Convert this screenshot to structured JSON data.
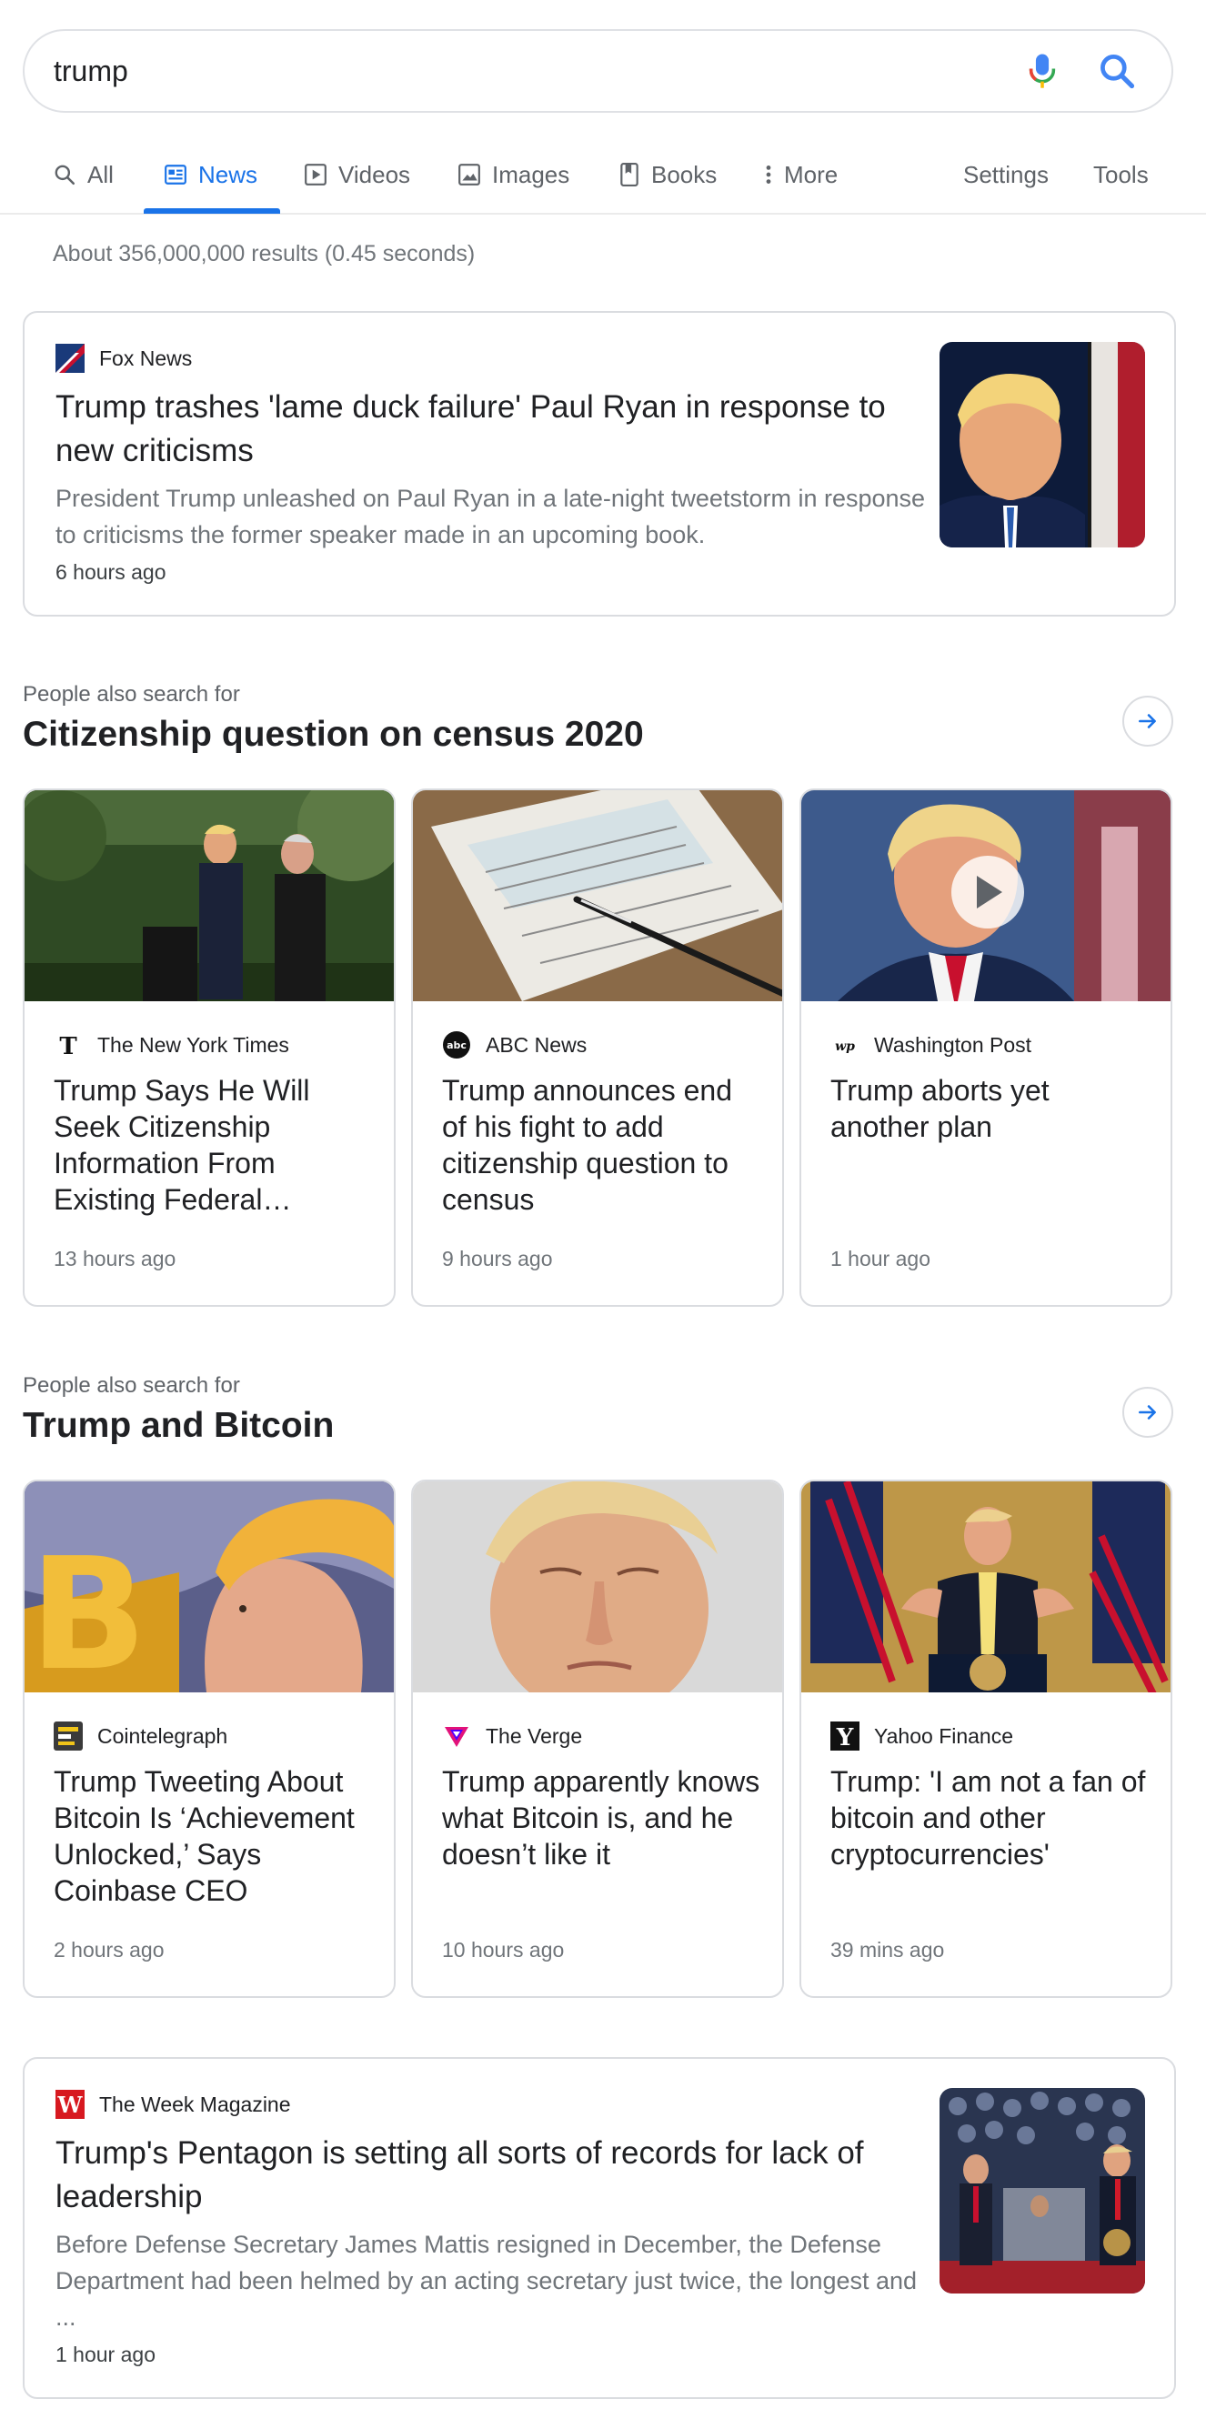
{
  "search": {
    "query": "trump"
  },
  "tabs": [
    {
      "label": "All",
      "icon": "search-icon"
    },
    {
      "label": "News",
      "icon": "news-icon",
      "active": true
    },
    {
      "label": "Videos",
      "icon": "play-icon"
    },
    {
      "label": "Images",
      "icon": "image-icon"
    },
    {
      "label": "Books",
      "icon": "book-icon"
    },
    {
      "label": "More",
      "icon": "more-vert-icon"
    },
    {
      "label": "Settings"
    },
    {
      "label": "Tools"
    }
  ],
  "result_stats": "About 356,000,000 results (0.45 seconds)",
  "top_story": {
    "source": "Fox News",
    "headline": "Trump trashes 'lame duck failure' Paul Ryan in response to new criticisms",
    "snippet": "President Trump unleashed on Paul Ryan in a late-night tweetstorm in response to criticisms the former speaker made in an upcoming book.",
    "time": "6 hours ago"
  },
  "section1": {
    "kicker": "People also search for",
    "title": "Citizenship question on census 2020",
    "cards": [
      {
        "source": "The New York Times",
        "title": "Trump Says He Will Seek Citizenship Information From Existing Federal…",
        "time": "13 hours ago"
      },
      {
        "source": "ABC News",
        "title": "Trump announces end of his fight to add citizenship question to census",
        "time": "9 hours ago"
      },
      {
        "source": "Washington Post",
        "title": "Trump aborts yet another plan",
        "time": "1 hour ago",
        "video": true
      }
    ]
  },
  "section2": {
    "kicker": "People also search for",
    "title": "Trump and Bitcoin",
    "cards": [
      {
        "source": "Cointelegraph",
        "title": "Trump Tweeting About Bitcoin Is ‘Achievement Unlocked,’ Says Coinbase CEO",
        "time": "2 hours ago"
      },
      {
        "source": "The Verge",
        "title": "Trump apparently knows what Bitcoin is, and he doesn’t like it",
        "time": "10 hours ago"
      },
      {
        "source": "Yahoo Finance",
        "title": "Trump: 'I am not a fan of bitcoin and other cryptocurrencies'",
        "time": "39 mins ago"
      }
    ]
  },
  "bottom_story": {
    "source": "The Week Magazine",
    "headline": "Trump's Pentagon is setting all sorts of records for lack of leadership",
    "snippet": "Before Defense Secretary James Mattis resigned in December, the Defense Department had been helmed by an acting secretary just twice, the longest and ...",
    "time": "1 hour ago"
  },
  "colors": {
    "accent": "#1a73e8",
    "text": "#202124",
    "muted": "#70757a",
    "border": "#dadce0"
  }
}
